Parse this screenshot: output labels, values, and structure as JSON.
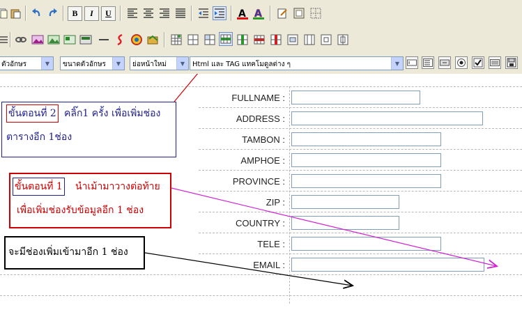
{
  "toolbar1": {
    "icons": [
      "cut-icon",
      "paste-icon",
      "undo-icon",
      "redo-icon",
      "bold-button",
      "italic-button",
      "underline-button",
      "align-left-icon",
      "align-center-icon",
      "align-right-icon",
      "justify-icon",
      "outdent-icon",
      "indent-icon",
      "text-color-icon",
      "highlight-color-icon",
      "edit-source-icon",
      "insert-form-icon",
      "show-borders-icon"
    ],
    "bold_label": "B",
    "italic_label": "I",
    "underline_label": "U",
    "font_color_letter": "A"
  },
  "toolbar2": {
    "icons": [
      "source-icon",
      "link-icon",
      "image-icon",
      "image2-icon",
      "image3-icon",
      "image4-icon",
      "hr-icon",
      "flash-icon",
      "media-icon",
      "gallery-icon",
      "insert-table-icon",
      "table-props-icon",
      "cell-props-icon",
      "insert-row-icon",
      "insert-col-icon",
      "delete-row-icon",
      "delete-col-icon",
      "merge-cells-icon",
      "split-cells-icon",
      "row-props-icon",
      "col-props-icon"
    ]
  },
  "toolbar3": {
    "font_select": "ตัวอักษร",
    "size_select": "ขนาดตัวอักษร",
    "paragraph_select": "ย่อหน้าใหม่",
    "html_select": "Html และ TAG แทคโมดูลต่าง ๆ",
    "form_controls": [
      "textfield-icon",
      "textarea-icon",
      "button-icon",
      "radio-icon",
      "checkbox-icon",
      "hidden-field-icon",
      "save-icon"
    ]
  },
  "form": {
    "labels": [
      "FULLNAME :",
      "ADDRESS :",
      "TAMBON :",
      "AMPHOE :",
      "PROVINCE :",
      "ZIP :",
      "COUNTRY :",
      "TELE :",
      "EMAIL :"
    ]
  },
  "notes": {
    "step2_tag": "ขั้นตอนที่ 2",
    "step2_text": "คลิ๊ก1 ครั้ง เพื่อเพิ่มช่อง",
    "step2_line2": "ตารางอีก 1ช่อง",
    "step1_tag": "ขั้นตอนที่ 1",
    "step1_text": "นำเม้ามาวางต่อท้าย",
    "step1_line2": "เพื่อเพิ่มช่องรับข้อมูลอีก 1 ช่อง",
    "result_text": "จะมีช่องเพิ่มเข้ามาอีก 1 ช่อง"
  },
  "colors": {
    "toolbar_bg": "#ece9d8",
    "note_blue": "#1f1f8f",
    "note_red": "#cc0000",
    "arrow_red": "#cc0000",
    "arrow_magenta": "#d020d0",
    "arrow_black": "#000000"
  }
}
